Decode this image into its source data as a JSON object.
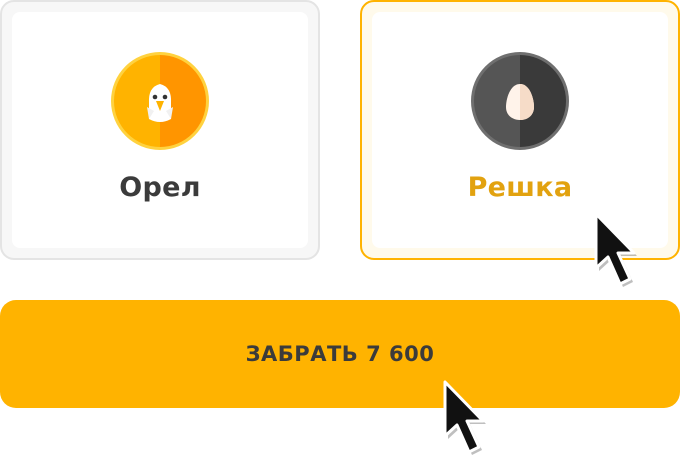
{
  "options": [
    {
      "label": "Орел",
      "icon": "eagle-icon",
      "selected": false
    },
    {
      "label": "Решка",
      "icon": "egg-icon",
      "selected": true
    }
  ],
  "collect_button": {
    "label": "ЗАБРАТЬ 7 600"
  },
  "colors": {
    "accent": "#ffb300",
    "selected_label": "#e2a20f",
    "text": "#3b3b3b",
    "coin_gold": "#ffb300",
    "coin_dark": "#4a4a4a"
  }
}
